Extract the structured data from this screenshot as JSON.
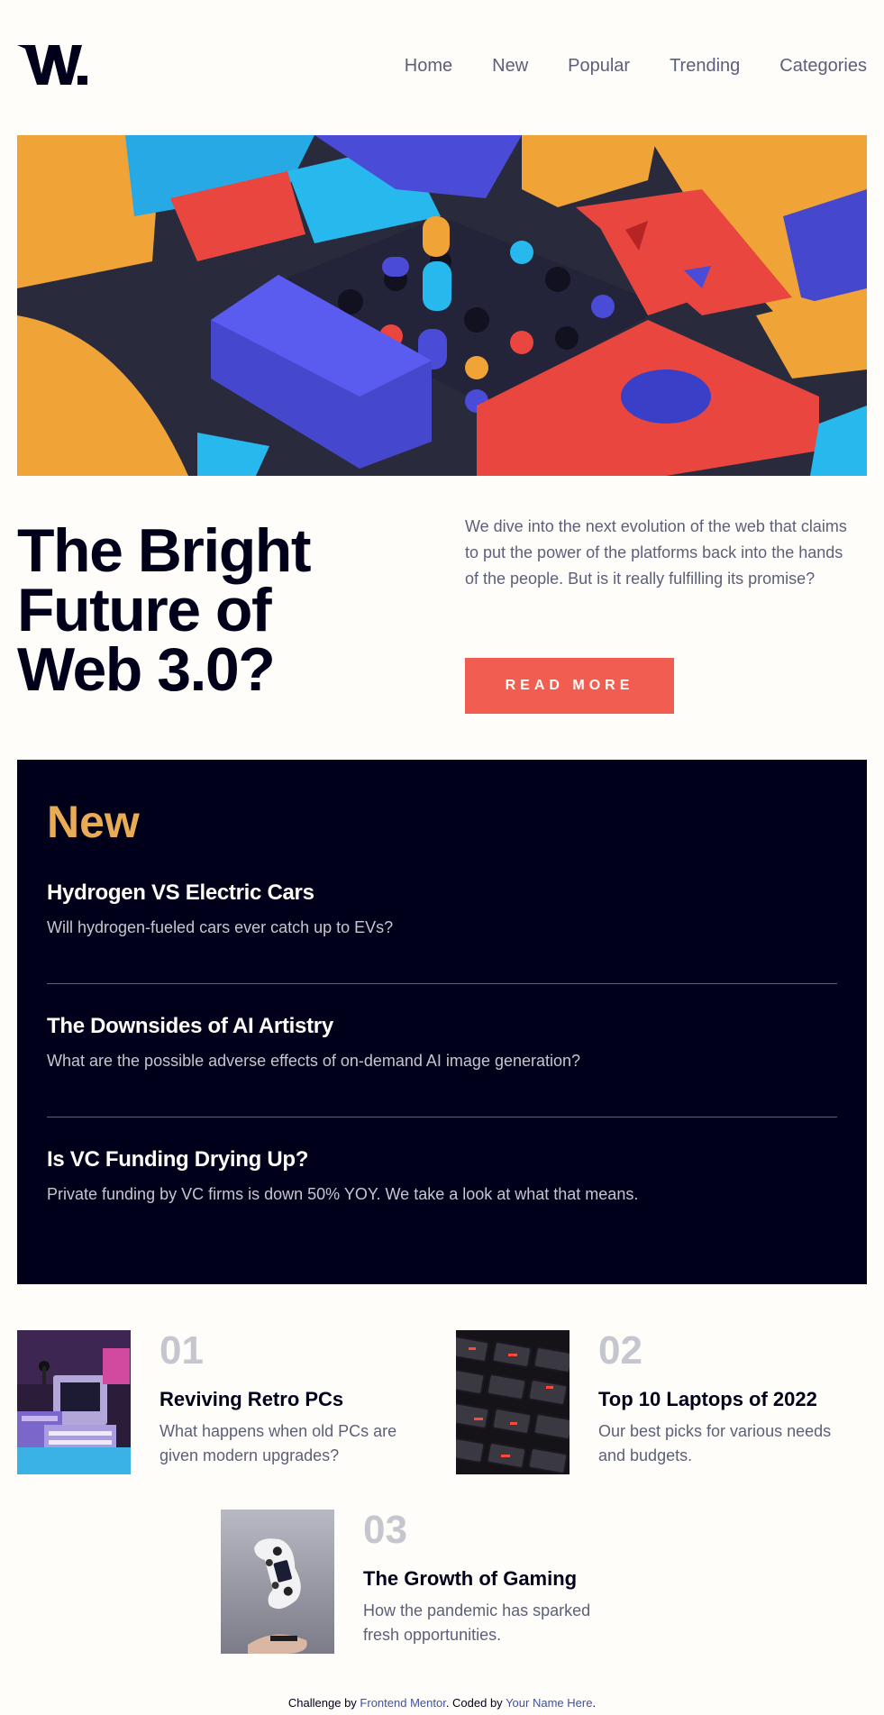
{
  "logo": {
    "text": "W.",
    "icon": "w-logo-icon"
  },
  "nav": {
    "items": [
      "Home",
      "New",
      "Popular",
      "Trending",
      "Categories"
    ]
  },
  "hero": {
    "title_lines": [
      "The Bright",
      "Future of",
      "Web 3.0?"
    ],
    "description": "We dive into the next evolution of the web that claims to put the power of the platforms back into the hands of the people. But is it really fulfilling its promise?",
    "cta_label": "READ MORE"
  },
  "new_section": {
    "heading": "New",
    "items": [
      {
        "title": "Hydrogen VS Electric Cars",
        "summary": "Will hydrogen-fueled cars ever catch up to EVs?"
      },
      {
        "title": "The Downsides of AI Artistry",
        "summary": "What are the possible adverse effects of on-demand AI image generation?"
      },
      {
        "title": "Is VC Funding Drying Up?",
        "summary": "Private funding by VC firms is down 50% YOY. We take a look at what that means."
      }
    ]
  },
  "trending": [
    {
      "number": "01",
      "title": "Reviving Retro PCs",
      "summary": "What happens when old PCs are given modern upgrades?",
      "image": "retro-pc-image"
    },
    {
      "number": "02",
      "title": "Top 10 Laptops of 2022",
      "summary": "Our best picks for various needs and budgets.",
      "image": "laptop-keyboard-image"
    },
    {
      "number": "03",
      "title": "The Growth of Gaming",
      "summary": "How the pandemic has sparked fresh opportunities.",
      "image": "game-controller-image"
    }
  ],
  "footer": {
    "prefix": "Challenge by ",
    "challenge_link": "Frontend Mentor",
    "middle": ". Coded by ",
    "author_link": "Your Name Here",
    "suffix": "."
  },
  "colors": {
    "accent_red": "#f15d51",
    "accent_orange": "#e9ab53",
    "dark_navy": "#00001a",
    "gray_blue": "#5d5f79",
    "grayish": "#c5c6ce",
    "off_white": "#fffdfa"
  }
}
